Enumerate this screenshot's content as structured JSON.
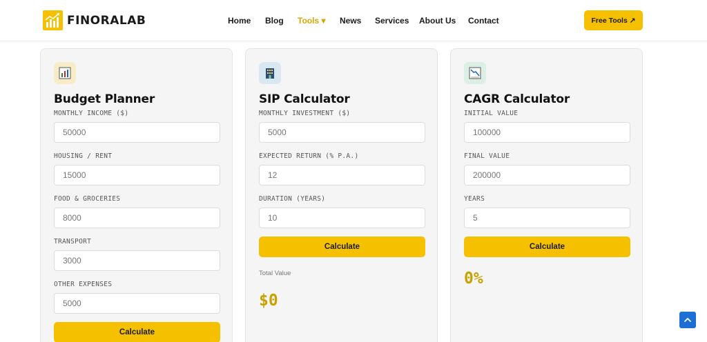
{
  "header": {
    "brand": "FINORALAB",
    "nav": [
      {
        "label": "Home"
      },
      {
        "label": "Blog"
      },
      {
        "label": "Tools ▾"
      },
      {
        "label": "News"
      },
      {
        "label": "Services"
      },
      {
        "label": "About Us"
      },
      {
        "label": "Contact"
      }
    ],
    "active_nav": "Tools ▾",
    "cta_label": "Free Tools ↗"
  },
  "cards": [
    {
      "title": "Budget Planner",
      "icon": "bar-chart-icon",
      "fields": [
        {
          "label": "MONTHLY INCOME ($)",
          "placeholder": "50000"
        },
        {
          "label": "HOUSING / RENT",
          "placeholder": "15000"
        },
        {
          "label": "FOOD & GROCERIES",
          "placeholder": "8000"
        },
        {
          "label": "TRANSPORT",
          "placeholder": "3000"
        },
        {
          "label": "OTHER EXPENSES",
          "placeholder": "5000"
        }
      ],
      "button": "Calculate"
    },
    {
      "title": "SIP Calculator",
      "icon": "building-icon",
      "fields": [
        {
          "label": "MONTHLY INVESTMENT ($)",
          "placeholder": "5000"
        },
        {
          "label": "EXPECTED RETURN (% P.A.)",
          "placeholder": "12"
        },
        {
          "label": "DURATION (YEARS)",
          "placeholder": "10"
        }
      ],
      "button": "Calculate",
      "result_label": "Total Value",
      "result_value": "$0"
    },
    {
      "title": "CAGR Calculator",
      "icon": "trend-chart-icon",
      "fields": [
        {
          "label": "INITIAL VALUE",
          "placeholder": "100000"
        },
        {
          "label": "FINAL VALUE",
          "placeholder": "200000"
        },
        {
          "label": "YEARS",
          "placeholder": "5"
        }
      ],
      "button": "Calculate",
      "result_value": "0%"
    }
  ],
  "colors": {
    "accent": "#f5c000",
    "result_text": "#c9a100",
    "active_nav": "#d4a700",
    "scroll_button": "#1d6fd6"
  },
  "scroll_top_icon": "chevron-up-icon"
}
